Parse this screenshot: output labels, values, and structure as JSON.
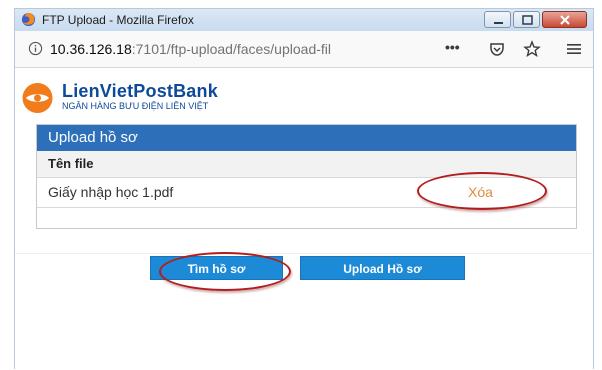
{
  "window": {
    "title": "FTP Upload - Mozilla Firefox",
    "controls": {
      "minimize": "minimize-icon",
      "maximize": "maximize-icon",
      "close": "close-icon"
    }
  },
  "navbar": {
    "url_host": "10.36.126.18",
    "url_rest": ":7101/ftp-upload/faces/upload-fil",
    "icons": [
      "info-icon",
      "more-icon",
      "pocket-icon",
      "bookmark-star-icon",
      "menu-icon"
    ],
    "more_label": "•••"
  },
  "page": {
    "logo": {
      "brand": "LienVietPostBank",
      "subtitle": "NGÂN HÀNG BƯU ĐIỆN LIÊN VIỆT",
      "colors": {
        "blue": "#0e4a9a",
        "orange": "#f07c1b"
      }
    },
    "panel": {
      "title": "Upload hồ sơ",
      "column_header": "Tên file",
      "rows": [
        {
          "file_name": "Giấy nhập học 1.pdf",
          "action": "Xóa"
        }
      ]
    },
    "buttons": {
      "find": "Tìm hồ sơ",
      "upload": "Upload Hồ sơ"
    },
    "colors": {
      "panel_header": "#2d6fb8",
      "button": "#1d8ad8",
      "delete_link": "#e08a3c",
      "highlight": "#b31d1d"
    }
  }
}
